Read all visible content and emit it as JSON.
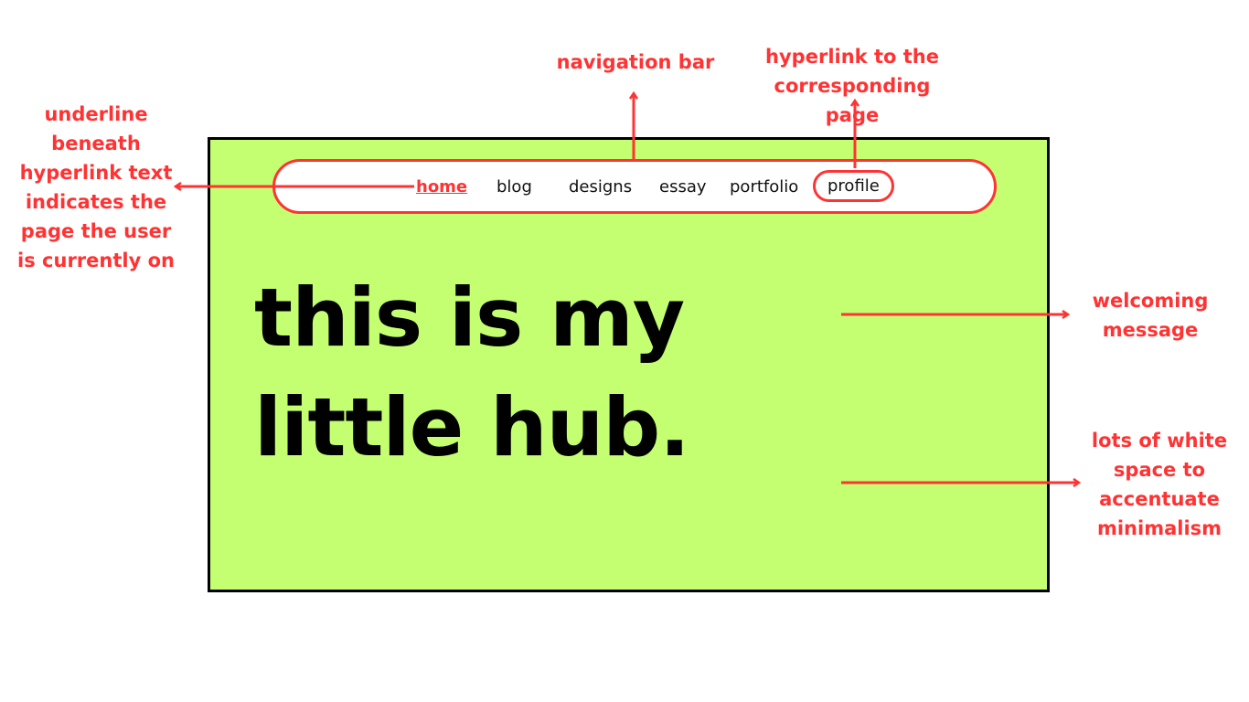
{
  "mockup": {
    "nav": {
      "items": [
        {
          "label": "home",
          "active": true
        },
        {
          "label": "blog"
        },
        {
          "label": "designs"
        },
        {
          "label": "essay"
        },
        {
          "label": "portfolio"
        },
        {
          "label": "profile",
          "highlighted": true
        }
      ]
    },
    "hero": "this is my little hub."
  },
  "annotations": {
    "navigation_bar": "navigation bar",
    "hyperlink": "hyperlink to the corresponding page",
    "underline": "underline beneath hyperlink text indicates the page the user is currently on",
    "welcoming": "welcoming message",
    "whitespace": "lots of white space to accentuate minimalism"
  },
  "colors": {
    "accent": "#ff3333",
    "background": "#c4ff72"
  }
}
